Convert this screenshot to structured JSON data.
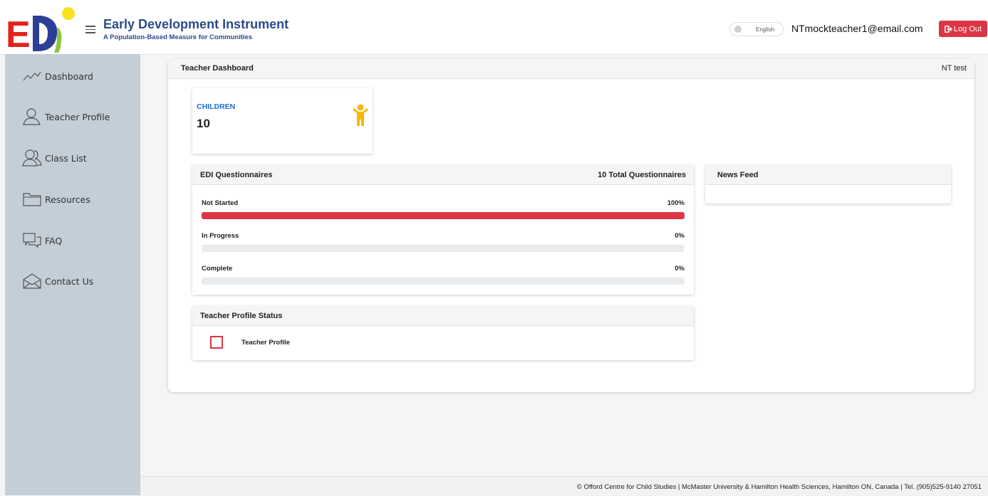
{
  "header": {
    "logo_text": "EDI",
    "title": "Early Development Instrument",
    "subtitle": "A Population-Based Measure for Communities",
    "language_label": "English",
    "user_email": "NTmockteacher1@email.com",
    "logout_label": "Log Out",
    "logout_color": "#dc3545"
  },
  "sidebar": {
    "items": [
      {
        "label": "Dashboard",
        "icon": "trend-line-icon"
      },
      {
        "label": "Teacher Profile",
        "icon": "user-icon"
      },
      {
        "label": "Class List",
        "icon": "users-icon"
      },
      {
        "label": "Resources",
        "icon": "folder-icon"
      },
      {
        "label": "FAQ",
        "icon": "chat-icon"
      },
      {
        "label": "Contact Us",
        "icon": "envelope-icon"
      }
    ]
  },
  "dashboard": {
    "title": "Teacher Dashboard",
    "class_name": "NT test",
    "children": {
      "label": "CHILDREN",
      "count": "10",
      "icon": "child-icon",
      "icon_color": "#f5b800"
    },
    "questionnaires": {
      "title": "EDI Questionnaires",
      "total": "10 Total Questionnaires",
      "rows": [
        {
          "label": "Not Started",
          "pct": "100%",
          "value": 100
        },
        {
          "label": "In Progress",
          "pct": "0%",
          "value": 0
        },
        {
          "label": "Complete",
          "pct": "0%",
          "value": 0
        }
      ]
    },
    "news_feed": {
      "title": "News Feed"
    },
    "teacher_profile_status": {
      "title": "Teacher Profile Status",
      "item_label": "Teacher Profile",
      "checked": false
    }
  },
  "footer": {
    "text": "© Offord Centre for Child Studies | McMaster University & Hamilton Health Sciences, Hamilton ON, Canada | Tel. (905)525-9140 27051"
  }
}
